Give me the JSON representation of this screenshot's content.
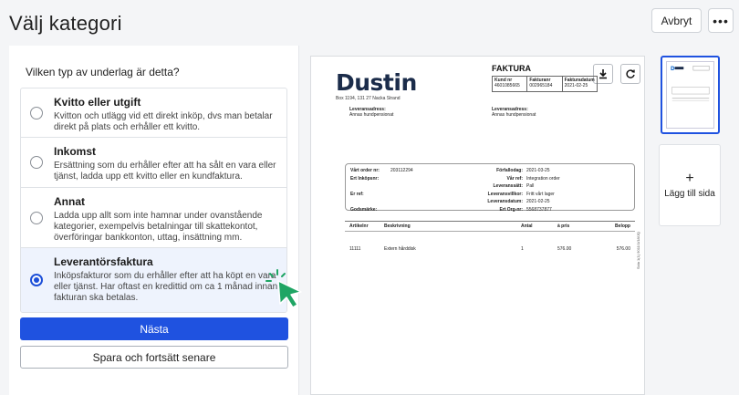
{
  "header": {
    "title": "Välj kategori",
    "cancel_label": "Avbryt",
    "more_label": "•••"
  },
  "form": {
    "question": "Vilken typ av underlag är detta?",
    "options": [
      {
        "title": "Kvitto eller utgift",
        "description": "Kvitton och utlägg vid ett direkt inköp, dvs man betalar direkt på plats och erhåller ett kvitto.",
        "selected": false
      },
      {
        "title": "Inkomst",
        "description": "Ersättning som du erhåller efter att ha sålt en vara eller tjänst, ladda upp ett kvitto eller en kundfaktura.",
        "selected": false
      },
      {
        "title": "Annat",
        "description": "Ladda upp allt som inte hamnar under ovanstående kategorier, exempelvis betalningar till skattekontot, överföringar bankkonton, uttag, insättning mm.",
        "selected": false
      },
      {
        "title": "Leverantörsfaktura",
        "description": "Inköpsfakturor som du erhåller efter att ha köpt en vara eller tjänst. Har oftast en kredittid om ca 1 månad innan fakturan ska betalas.",
        "selected": true
      }
    ],
    "next_label": "Nästa",
    "save_label": "Spara och fortsätt senare"
  },
  "invoice": {
    "logo": "Dustin",
    "address": "Box 1194, 131 27 Nacka Strand",
    "title": "FAKTURA",
    "header_cells": [
      {
        "label": "Kund nr",
        "value": "4601085665"
      },
      {
        "label": "Fakturanr",
        "value": "002965184"
      },
      {
        "label": "Fakturadatum",
        "value": "2021-02-25"
      }
    ],
    "delivery_left": {
      "label": "Leveransadress:",
      "value": "Annas hundpensionat"
    },
    "delivery_right": {
      "label": "Leveransadress:",
      "value": "Annas hundpensionat"
    },
    "info_left": [
      {
        "k": "Vårt order nr:",
        "v": "203112294"
      },
      {
        "k": "Ert Inköpsnr:",
        "v": ""
      },
      {
        "k": "",
        "v": ""
      },
      {
        "k": "Er ref:",
        "v": ""
      },
      {
        "k": "",
        "v": ""
      },
      {
        "k": "Godsmärke:",
        "v": ""
      }
    ],
    "info_right": [
      {
        "k": "Förfallodag:",
        "v": "2021-03-25"
      },
      {
        "k": "Vår ref:",
        "v": "Integration order"
      },
      {
        "k": "Leveranssätt:",
        "v": "Pall"
      },
      {
        "k": "Leveransvillkor:",
        "v": "Fritt vårt lager"
      },
      {
        "k": "Leveransdatum:",
        "v": "2021-02-25"
      },
      {
        "k": "Ert Org-nr:",
        "v": "5568737877"
      }
    ],
    "columns": [
      "Artikelnr",
      "Beskrivning",
      "Antal",
      "à pris",
      "Belopp"
    ],
    "rows": [
      [
        "11111",
        "Extern hårddisk",
        "1",
        "576.00",
        "576.00"
      ]
    ],
    "side_text": "Sida 1(1) 9011/1/18/JQ"
  },
  "pages": {
    "add_label": "Lägg till sida",
    "add_icon": "+"
  }
}
